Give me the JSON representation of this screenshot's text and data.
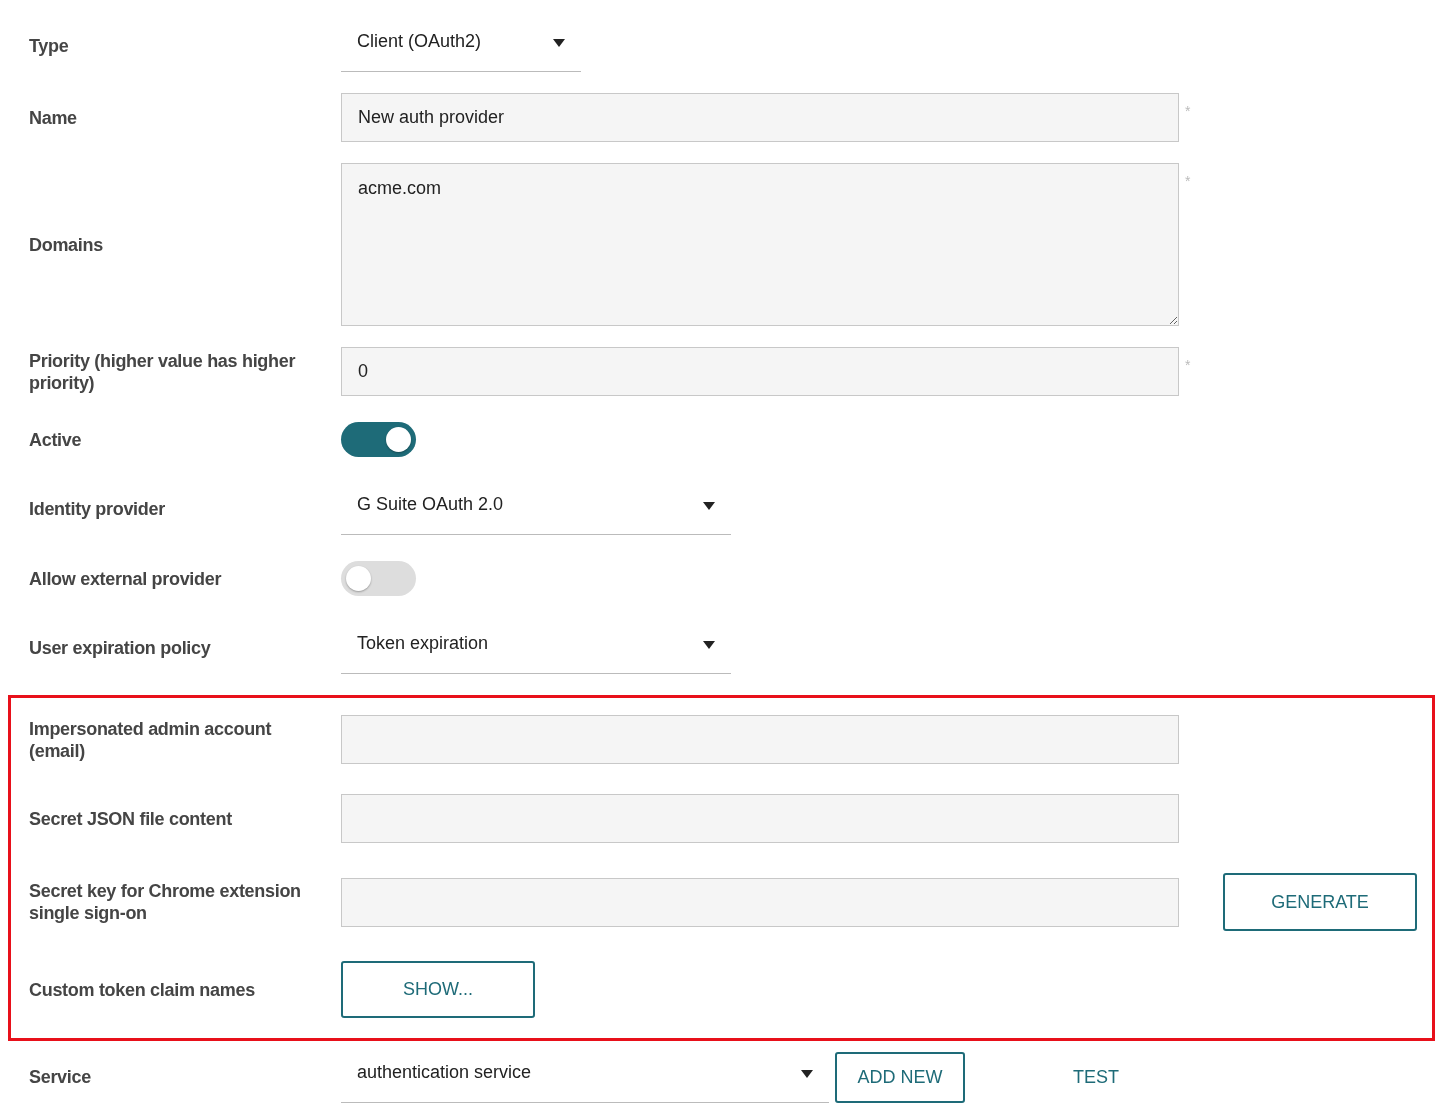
{
  "fields": [
    {
      "kind": "select",
      "label": "Type",
      "value": "Client (OAuth2)"
    },
    {
      "kind": "input",
      "label": "Name",
      "value": "New auth provider",
      "required_mark": "*"
    },
    {
      "kind": "textarea",
      "label": "Domains",
      "value": "acme.com",
      "required_mark": "*"
    },
    {
      "kind": "input",
      "label": "Priority (higher value has higher priority)",
      "value": "0",
      "required_mark": "*"
    },
    {
      "kind": "toggle",
      "label": "Active",
      "on": true
    },
    {
      "kind": "select",
      "label": "Identity provider",
      "value": "G Suite OAuth 2.0"
    },
    {
      "kind": "toggle",
      "label": "Allow external provider",
      "on": false
    },
    {
      "kind": "select",
      "label": "User expiration policy",
      "value": "Token expiration"
    }
  ],
  "highlighted_fields": [
    {
      "kind": "input",
      "label": "Impersonated admin account (email)"
    },
    {
      "kind": "input",
      "label": "Secret JSON file content"
    },
    {
      "kind": "input",
      "label": "Secret key for Chrome extension single sign-on",
      "action": "GENERATE"
    },
    {
      "kind": "button",
      "label": "Custom token claim names",
      "button": "SHOW..."
    }
  ],
  "service": {
    "label": "Service",
    "value": "authentication service",
    "actions": [
      {
        "label": "ADD NEW",
        "outlined": true
      },
      {
        "label": "TEST",
        "outlined": false
      }
    ]
  }
}
